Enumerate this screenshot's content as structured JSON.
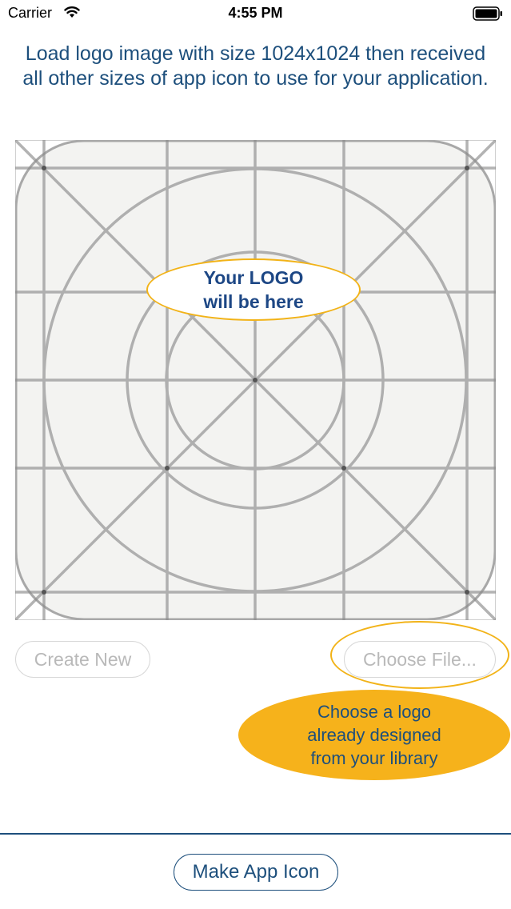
{
  "status_bar": {
    "carrier": "Carrier",
    "time": "4:55 PM",
    "wifi_icon": "wifi-icon",
    "battery_icon": "battery-full-icon"
  },
  "header": {
    "instructions": "Load logo image with size 1024x1024 then received all other sizes of app icon to use for your application."
  },
  "icon_preview": {
    "placeholder_graphic": "ios-app-icon-grid",
    "logo_placeholder_text": "Your LOGO\nwill be here"
  },
  "actions": {
    "create_new_label": "Create New",
    "choose_file_label": "Choose File...",
    "choose_tip": "Choose a logo\nalready designed\nfrom your library",
    "make_app_icon_label": "Make App Icon"
  },
  "colors": {
    "primary_text": "#1d4f7c",
    "accent": "#f6b21b",
    "disabled_text": "#b9b9b9",
    "grid_fill": "#f3f3f1"
  }
}
